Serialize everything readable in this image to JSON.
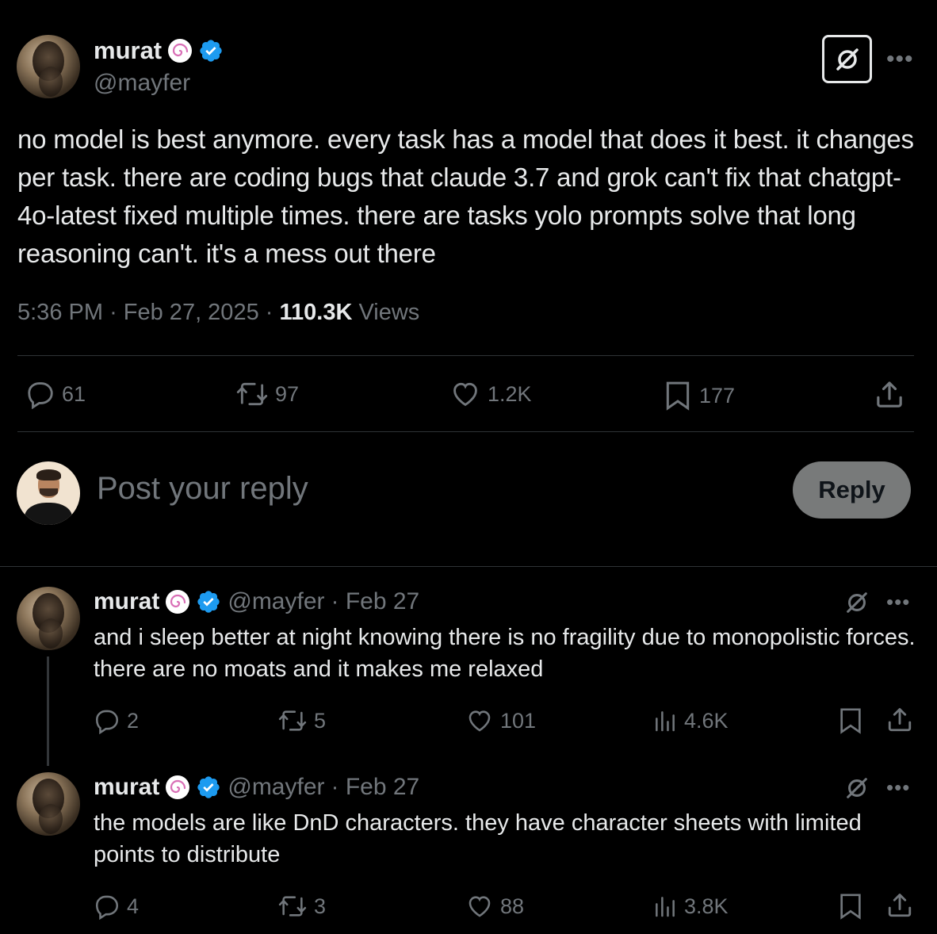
{
  "main_tweet": {
    "author_name": "murat",
    "author_handle": "@mayfer",
    "text": "no model is best anymore. every task has a model that does it best. it changes per task. there are coding bugs that claude 3.7 and grok can't fix that chatgpt-4o-latest fixed multiple times. there are tasks yolo prompts solve that long reasoning can't. it's a mess out there",
    "time": "5:36 PM",
    "date": "Feb 27, 2025",
    "views_count": "110.3K",
    "views_label": "Views",
    "replies": "61",
    "reposts": "97",
    "likes": "1.2K",
    "bookmarks": "177"
  },
  "reply_box": {
    "placeholder": "Post your reply",
    "button_label": "Reply"
  },
  "replies": [
    {
      "author_name": "murat",
      "handle": "@mayfer",
      "date": "· Feb 27",
      "text": "and i sleep better at night knowing there is no fragility due to monopolistic forces. there are no moats and it makes me relaxed",
      "replies": "2",
      "reposts": "5",
      "likes": "101",
      "views": "4.6K"
    },
    {
      "author_name": "murat",
      "handle": "@mayfer",
      "date": "· Feb 27",
      "text": "the models are like DnD characters. they have character sheets with limited points to distribute",
      "replies": "4",
      "reposts": "3",
      "likes": "88",
      "views": "3.8K"
    }
  ],
  "colors": {
    "background": "#000000",
    "text": "#e7e9ea",
    "muted": "#71767b",
    "verified": "#1d9bf0",
    "divider": "#2f3336",
    "reply_button": "#787a7a"
  },
  "icons": [
    "spiral-badge-icon",
    "verified-icon",
    "grok-icon",
    "more-icon",
    "reply-icon",
    "repost-icon",
    "like-icon",
    "bookmark-icon",
    "share-icon",
    "views-icon"
  ]
}
